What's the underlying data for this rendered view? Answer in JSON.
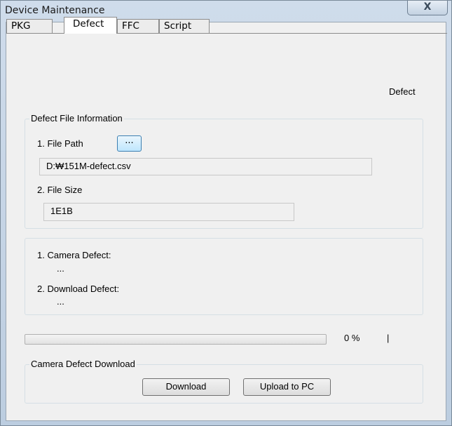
{
  "window": {
    "title": "Device Maintenance",
    "close_glyph": "X"
  },
  "tabs": [
    {
      "label": "PKG",
      "active": false
    },
    {
      "label": "Defect",
      "active": true
    },
    {
      "label": "FFC",
      "active": false
    },
    {
      "label": "Script",
      "active": false
    }
  ],
  "page": {
    "heading": "Defect",
    "file_info": {
      "title": "Defect File Information",
      "path_label": "1. File Path",
      "browse_label": "...",
      "path_value": "D:₩151M-defect.csv",
      "size_label": "2. File Size",
      "size_value": "1E1B"
    },
    "status": {
      "camera_label": "1. Camera Defect:",
      "camera_value": "...",
      "download_label": "2. Download Defect:",
      "download_value": "..."
    },
    "progress": {
      "percent": 0,
      "text": "0 %",
      "separator": "|"
    },
    "download_group": {
      "title": "Camera Defect Download",
      "download_button": "Download",
      "upload_button": "Upload to PC"
    }
  },
  "colors": {
    "progress_fill": "#06b025",
    "titlebar": "#c4d4e6"
  }
}
